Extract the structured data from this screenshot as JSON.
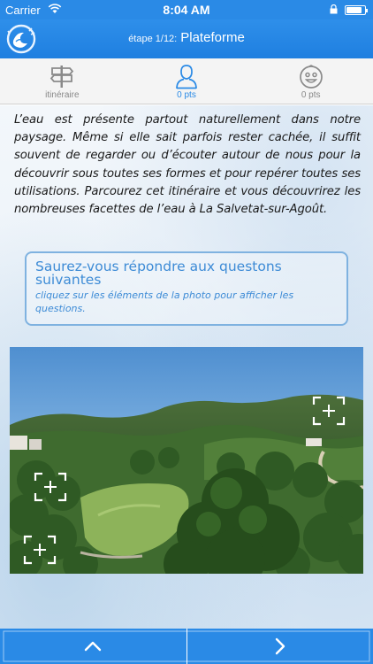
{
  "status_bar": {
    "carrier": "Carrier",
    "time": "8:04 AM"
  },
  "nav": {
    "step": "étape 1/12:",
    "title": "Plateforme"
  },
  "tabs": [
    {
      "label": "itinéraire",
      "icon": "signpost-icon",
      "active": false
    },
    {
      "label": "0 pts",
      "icon": "person-icon",
      "active": true
    },
    {
      "label": "0 pts",
      "icon": "smiley-icon",
      "active": false
    }
  ],
  "intro_text": "L’eau est présente partout naturellement dans notre paysage. Même si elle sait parfois rester cachée, il suffit souvent de regarder ou d’écouter autour de nous pour la découvrir sous toutes ses formes et pour repérer toutes ses utilisations. Parcourez cet itinéraire et vous découvrirez les nombreuses facettes de l’eau à La Salvetat-sur-Agoût.",
  "question_box": {
    "title": "Saurez-vous répondre aux questons suivantes",
    "hint": "cliquez sur les éléments de la photo pour afficher les questions."
  },
  "bottom_nav": {
    "prev_icon": "chevron-up-icon",
    "next_icon": "chevron-right-icon"
  },
  "colors": {
    "accent": "#2a8ae6",
    "question_text": "#3d8bd6"
  }
}
